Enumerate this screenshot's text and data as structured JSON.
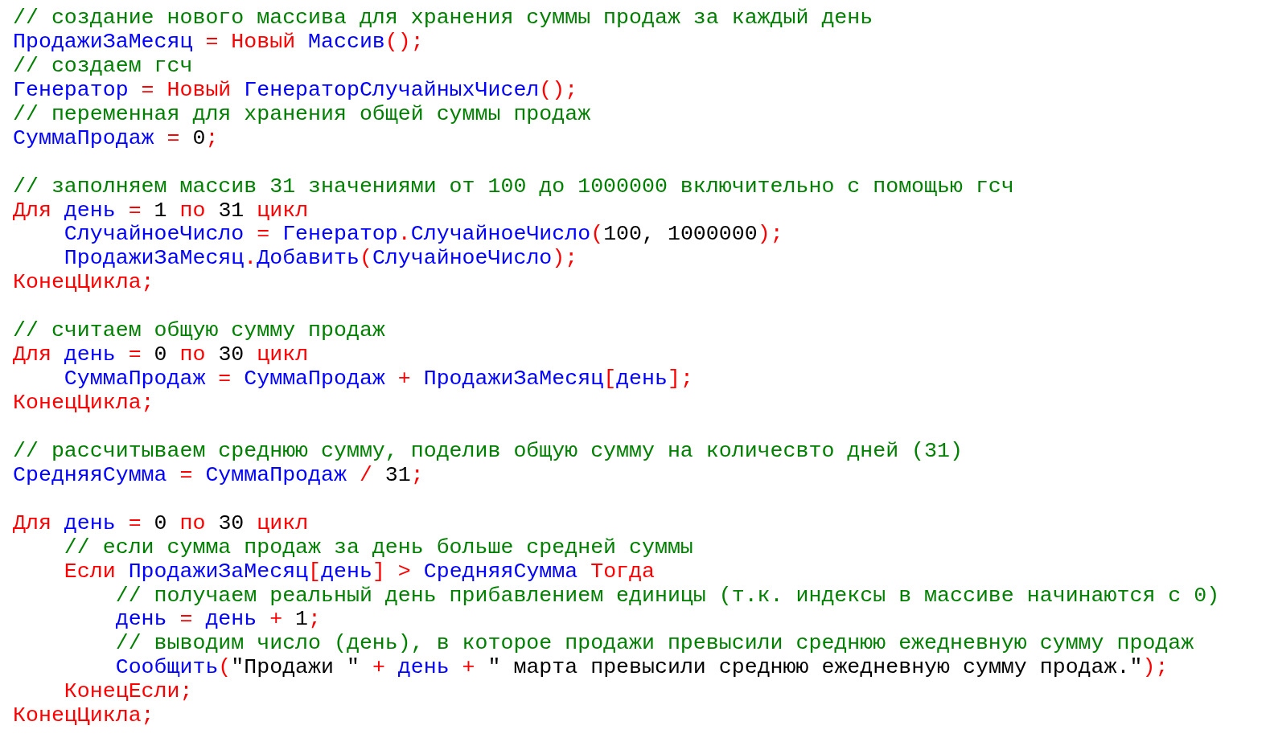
{
  "code_lines": [
    {
      "kind": "code",
      "tokens": [
        {
          "kind": "comment",
          "text": "// создание нового массива для хранения суммы продаж за каждый день"
        }
      ]
    },
    {
      "kind": "code",
      "tokens": [
        {
          "kind": "ident",
          "text": "ПродажиЗаМесяц "
        },
        {
          "kind": "op",
          "text": "= Новый "
        },
        {
          "kind": "ident",
          "text": "Массив"
        },
        {
          "kind": "op",
          "text": "();"
        }
      ]
    },
    {
      "kind": "code",
      "tokens": [
        {
          "kind": "comment",
          "text": "// создаем гсч"
        }
      ]
    },
    {
      "kind": "code",
      "tokens": [
        {
          "kind": "ident",
          "text": "Генератор "
        },
        {
          "kind": "op",
          "text": "= Новый "
        },
        {
          "kind": "ident",
          "text": "ГенераторСлучайныхЧисел"
        },
        {
          "kind": "op",
          "text": "();"
        }
      ]
    },
    {
      "kind": "code",
      "tokens": [
        {
          "kind": "comment",
          "text": "// переменная для хранения общей суммы продаж"
        }
      ]
    },
    {
      "kind": "code",
      "tokens": [
        {
          "kind": "ident",
          "text": "СуммаПродаж "
        },
        {
          "kind": "op",
          "text": "= "
        },
        {
          "kind": "lit",
          "text": "0"
        },
        {
          "kind": "op",
          "text": ";"
        }
      ]
    },
    {
      "kind": "blank"
    },
    {
      "kind": "code",
      "tokens": [
        {
          "kind": "comment",
          "text": "// заполняем массив 31 значениями от 100 до 1000000 включительно с помощью гсч"
        }
      ]
    },
    {
      "kind": "code",
      "tokens": [
        {
          "kind": "op",
          "text": "Для "
        },
        {
          "kind": "ident",
          "text": "день "
        },
        {
          "kind": "op",
          "text": "= "
        },
        {
          "kind": "lit",
          "text": "1 "
        },
        {
          "kind": "op",
          "text": "по "
        },
        {
          "kind": "lit",
          "text": "31 "
        },
        {
          "kind": "op",
          "text": "цикл"
        }
      ]
    },
    {
      "kind": "code",
      "tokens": [
        {
          "kind": "ident",
          "text": "    СлучайноеЧисло "
        },
        {
          "kind": "op",
          "text": "= "
        },
        {
          "kind": "ident",
          "text": "Генератор"
        },
        {
          "kind": "op",
          "text": "."
        },
        {
          "kind": "ident",
          "text": "СлучайноеЧисло"
        },
        {
          "kind": "op",
          "text": "("
        },
        {
          "kind": "lit",
          "text": "100, 1000000"
        },
        {
          "kind": "op",
          "text": ");"
        }
      ]
    },
    {
      "kind": "code",
      "tokens": [
        {
          "kind": "ident",
          "text": "    ПродажиЗаМесяц"
        },
        {
          "kind": "op",
          "text": "."
        },
        {
          "kind": "ident",
          "text": "Добавить"
        },
        {
          "kind": "op",
          "text": "("
        },
        {
          "kind": "ident",
          "text": "СлучайноеЧисло"
        },
        {
          "kind": "op",
          "text": ");"
        }
      ]
    },
    {
      "kind": "code",
      "tokens": [
        {
          "kind": "op",
          "text": "КонецЦикла;"
        }
      ]
    },
    {
      "kind": "blank"
    },
    {
      "kind": "code",
      "tokens": [
        {
          "kind": "comment",
          "text": "// считаем общую сумму продаж"
        }
      ]
    },
    {
      "kind": "code",
      "tokens": [
        {
          "kind": "op",
          "text": "Для "
        },
        {
          "kind": "ident",
          "text": "день "
        },
        {
          "kind": "op",
          "text": "= "
        },
        {
          "kind": "lit",
          "text": "0 "
        },
        {
          "kind": "op",
          "text": "по "
        },
        {
          "kind": "lit",
          "text": "30 "
        },
        {
          "kind": "op",
          "text": "цикл"
        }
      ]
    },
    {
      "kind": "code",
      "tokens": [
        {
          "kind": "ident",
          "text": "    СуммаПродаж "
        },
        {
          "kind": "op",
          "text": "= "
        },
        {
          "kind": "ident",
          "text": "СуммаПродаж "
        },
        {
          "kind": "op",
          "text": "+ "
        },
        {
          "kind": "ident",
          "text": "ПродажиЗаМесяц"
        },
        {
          "kind": "op",
          "text": "["
        },
        {
          "kind": "ident",
          "text": "день"
        },
        {
          "kind": "op",
          "text": "];"
        }
      ]
    },
    {
      "kind": "code",
      "tokens": [
        {
          "kind": "op",
          "text": "КонецЦикла;"
        }
      ]
    },
    {
      "kind": "blank"
    },
    {
      "kind": "code",
      "tokens": [
        {
          "kind": "comment",
          "text": "// рассчитываем среднюю сумму, поделив общую сумму на количесвто дней (31)"
        }
      ]
    },
    {
      "kind": "code",
      "tokens": [
        {
          "kind": "ident",
          "text": "СредняяСумма "
        },
        {
          "kind": "op",
          "text": "= "
        },
        {
          "kind": "ident",
          "text": "СуммаПродаж "
        },
        {
          "kind": "op",
          "text": "/ "
        },
        {
          "kind": "lit",
          "text": "31"
        },
        {
          "kind": "op",
          "text": ";"
        }
      ]
    },
    {
      "kind": "blank"
    },
    {
      "kind": "code",
      "tokens": [
        {
          "kind": "op",
          "text": "Для "
        },
        {
          "kind": "ident",
          "text": "день "
        },
        {
          "kind": "op",
          "text": "= "
        },
        {
          "kind": "lit",
          "text": "0 "
        },
        {
          "kind": "op",
          "text": "по "
        },
        {
          "kind": "lit",
          "text": "30 "
        },
        {
          "kind": "op",
          "text": "цикл"
        }
      ]
    },
    {
      "kind": "code",
      "tokens": [
        {
          "kind": "comment",
          "text": "    // если сумма продаж за день больше средней суммы"
        }
      ]
    },
    {
      "kind": "code",
      "tokens": [
        {
          "kind": "op",
          "text": "    Если "
        },
        {
          "kind": "ident",
          "text": "ПродажиЗаМесяц"
        },
        {
          "kind": "op",
          "text": "["
        },
        {
          "kind": "ident",
          "text": "день"
        },
        {
          "kind": "op",
          "text": "] > "
        },
        {
          "kind": "ident",
          "text": "СредняяСумма "
        },
        {
          "kind": "op",
          "text": "Тогда"
        }
      ]
    },
    {
      "kind": "code",
      "tokens": [
        {
          "kind": "comment",
          "text": "        // получаем реальный день прибавлением единицы (т.к. индексы в массиве начинаются с 0)"
        }
      ]
    },
    {
      "kind": "code",
      "tokens": [
        {
          "kind": "ident",
          "text": "        день "
        },
        {
          "kind": "op",
          "text": "= "
        },
        {
          "kind": "ident",
          "text": "день "
        },
        {
          "kind": "op",
          "text": "+ "
        },
        {
          "kind": "lit",
          "text": "1"
        },
        {
          "kind": "op",
          "text": ";"
        }
      ]
    },
    {
      "kind": "code",
      "tokens": [
        {
          "kind": "comment",
          "text": "        // выводим число (день), в которое продажи превысили среднюю ежедневную сумму продаж"
        }
      ]
    },
    {
      "kind": "code",
      "tokens": [
        {
          "kind": "ident",
          "text": "        Сообщить"
        },
        {
          "kind": "op",
          "text": "("
        },
        {
          "kind": "lit",
          "text": "\"Продажи \" "
        },
        {
          "kind": "op",
          "text": "+ "
        },
        {
          "kind": "ident",
          "text": "день "
        },
        {
          "kind": "op",
          "text": "+ "
        },
        {
          "kind": "lit",
          "text": "\" марта превысили среднюю ежедневную сумму продаж.\""
        },
        {
          "kind": "op",
          "text": ");"
        }
      ]
    },
    {
      "kind": "code",
      "tokens": [
        {
          "kind": "op",
          "text": "    КонецЕсли;"
        }
      ]
    },
    {
      "kind": "code",
      "tokens": [
        {
          "kind": "op",
          "text": "КонецЦикла;"
        }
      ]
    }
  ]
}
